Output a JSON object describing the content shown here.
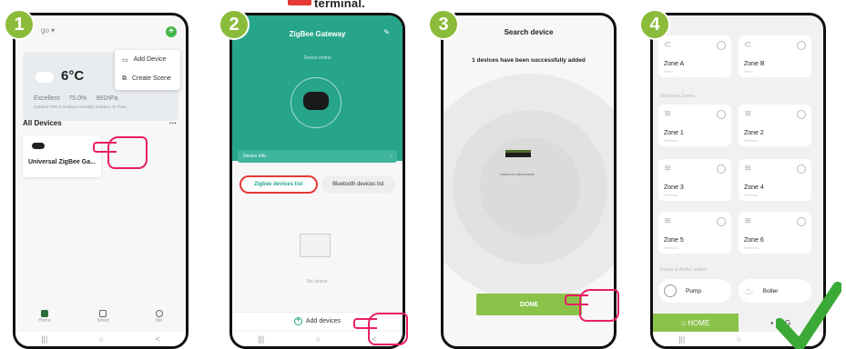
{
  "header_partial_text": "terminal.",
  "steps": [
    "1",
    "2",
    "3",
    "4"
  ],
  "phone1": {
    "location": "go",
    "menu_items": [
      "Add Device",
      "Create Scene"
    ],
    "temperature": "6°C",
    "stats": [
      "Excellent",
      "75.0%",
      "991hPa"
    ],
    "stats_sub": "Outdoor PM2.5   Outdoor Humidity   Outdoor Air Pres...",
    "section_label": "All Devices",
    "more": "···",
    "device_name": "Universal ZigBee Ga...",
    "tabs": [
      "Home",
      "Smart",
      "Me"
    ]
  },
  "phone2": {
    "title": "ZigBee Gateway",
    "status": "Device online",
    "info_label": "Device Info",
    "tab_zigbee": "Zigbee devices list",
    "tab_bluetooth": "Bluetooth devices list",
    "empty_label": "No device",
    "add_label": "Add devices"
  },
  "phone3": {
    "title": "Search device",
    "message": "1 devices have been successfully added",
    "device_label": "Listwa do sterowania...",
    "done_label": "DONE"
  },
  "phone4": {
    "section_wireless": "Wireless Zones",
    "section_pump": "Pump & Boiler status",
    "zones": [
      {
        "name": "Zone A",
        "sub": "Wired"
      },
      {
        "name": "Zone B",
        "sub": "Wired"
      },
      {
        "name": "Zone 1",
        "sub": "Wireless"
      },
      {
        "name": "Zone 2",
        "sub": "Wireless"
      },
      {
        "name": "Zone 3",
        "sub": "Wireless"
      },
      {
        "name": "Zone 4",
        "sub": "Wireless"
      },
      {
        "name": "Zone 5",
        "sub": "Wireless"
      },
      {
        "name": "Zone 6",
        "sub": "Wireless"
      }
    ],
    "pump_label": "Pump",
    "boiler_label": "Boiler",
    "tab_home": "HOME",
    "tab_log": "LOG"
  },
  "nav_buttons": [
    "|||",
    "○",
    "<"
  ],
  "colors": {
    "step_badge": "#8bbb3a",
    "gateway_green": "#27a58a",
    "accent_green": "#8bc34a",
    "highlight_red": "#e53935",
    "hand_pink": "#e91e63"
  }
}
